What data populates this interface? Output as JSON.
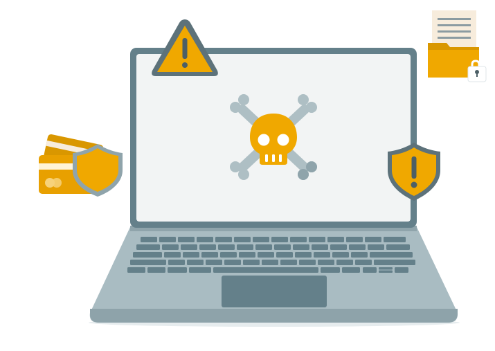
{
  "illustration": {
    "icons": [
      "laptop-icon",
      "skull-crossbones-icon",
      "warning-triangle-icon",
      "locked-document-folder-icon",
      "credit-cards-shield-icon",
      "warning-shield-icon"
    ]
  },
  "colors": {
    "laptop_frame": "#64808a",
    "laptop_screen": "#f2f4f4",
    "laptop_base": "#9fb3ba",
    "keyboard_keys": "#64808a",
    "touchpad": "#64808a",
    "bones": "#aebfc4",
    "accent_yellow": "#f0a800",
    "accent_yellow_dark": "#d99700",
    "warning_mark": "#4c5f66",
    "document_paper": "#f7ecdc",
    "document_lines": "#8b9ba1"
  }
}
